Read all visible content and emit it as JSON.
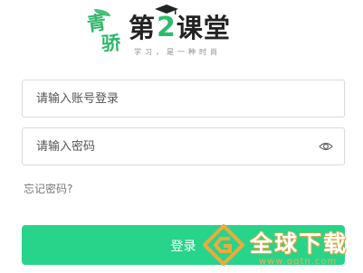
{
  "logo": {
    "badge_top": "青",
    "badge_bottom": "骄",
    "word_prefix": "第",
    "word_number": "2",
    "word_suffix": "课堂",
    "tagline": "学习，是一种时尚"
  },
  "form": {
    "account_placeholder": "请输入账号登录",
    "password_placeholder": "请输入密码",
    "forgot_password": "忘记密码?",
    "login_label": "登录"
  },
  "watermark": {
    "text": "全球下载",
    "url": "www.qqtn.com"
  },
  "colors": {
    "brand_green": "#2bbd6c",
    "button_green": "#28d48a",
    "border": "#d9d9d9",
    "watermark_orange": "#e8a53b"
  },
  "icons": {
    "password_toggle": "eye-icon",
    "logo_cap": "graduation-cap-icon"
  }
}
